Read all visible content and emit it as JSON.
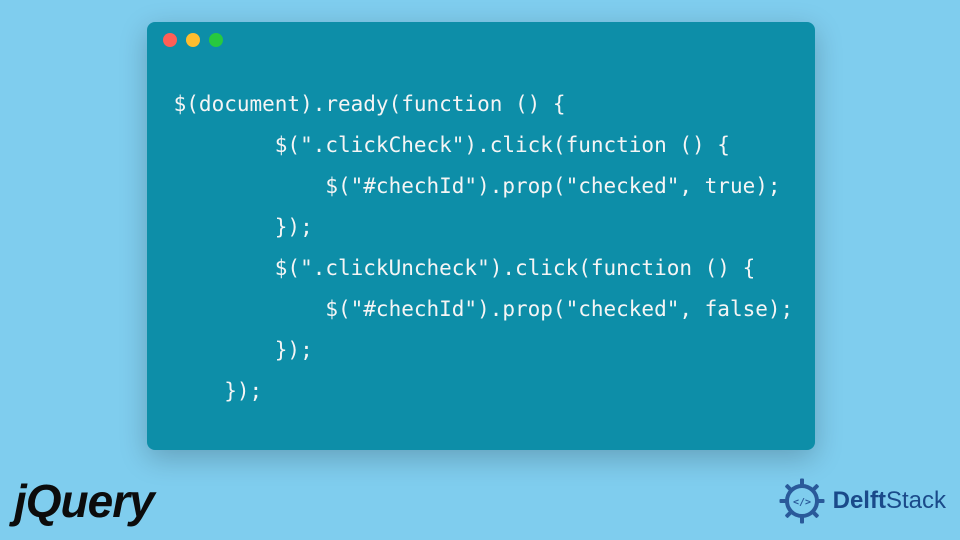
{
  "window": {
    "dot_red": "#ff5f56",
    "dot_yellow": "#ffbd2e",
    "dot_green": "#27c93f"
  },
  "code": {
    "line1": " $(document).ready(function () {",
    "line2": "         $(\".clickCheck\").click(function () {",
    "line3": "             $(\"#chechId\").prop(\"checked\", true);",
    "line4": "         });",
    "line5": "         $(\".clickUncheck\").click(function () {",
    "line6": "             $(\"#chechId\").prop(\"checked\", false);",
    "line7": "         });",
    "line8": "     });"
  },
  "logos": {
    "jquery": "jQuery",
    "delft_prefix": "Delft",
    "delft_suffix": "Stack"
  },
  "colors": {
    "page_bg": "#7fcdee",
    "window_bg": "#0d8ea8",
    "code_text": "#f5f5f5",
    "delft_blue": "#1a4a8a"
  }
}
